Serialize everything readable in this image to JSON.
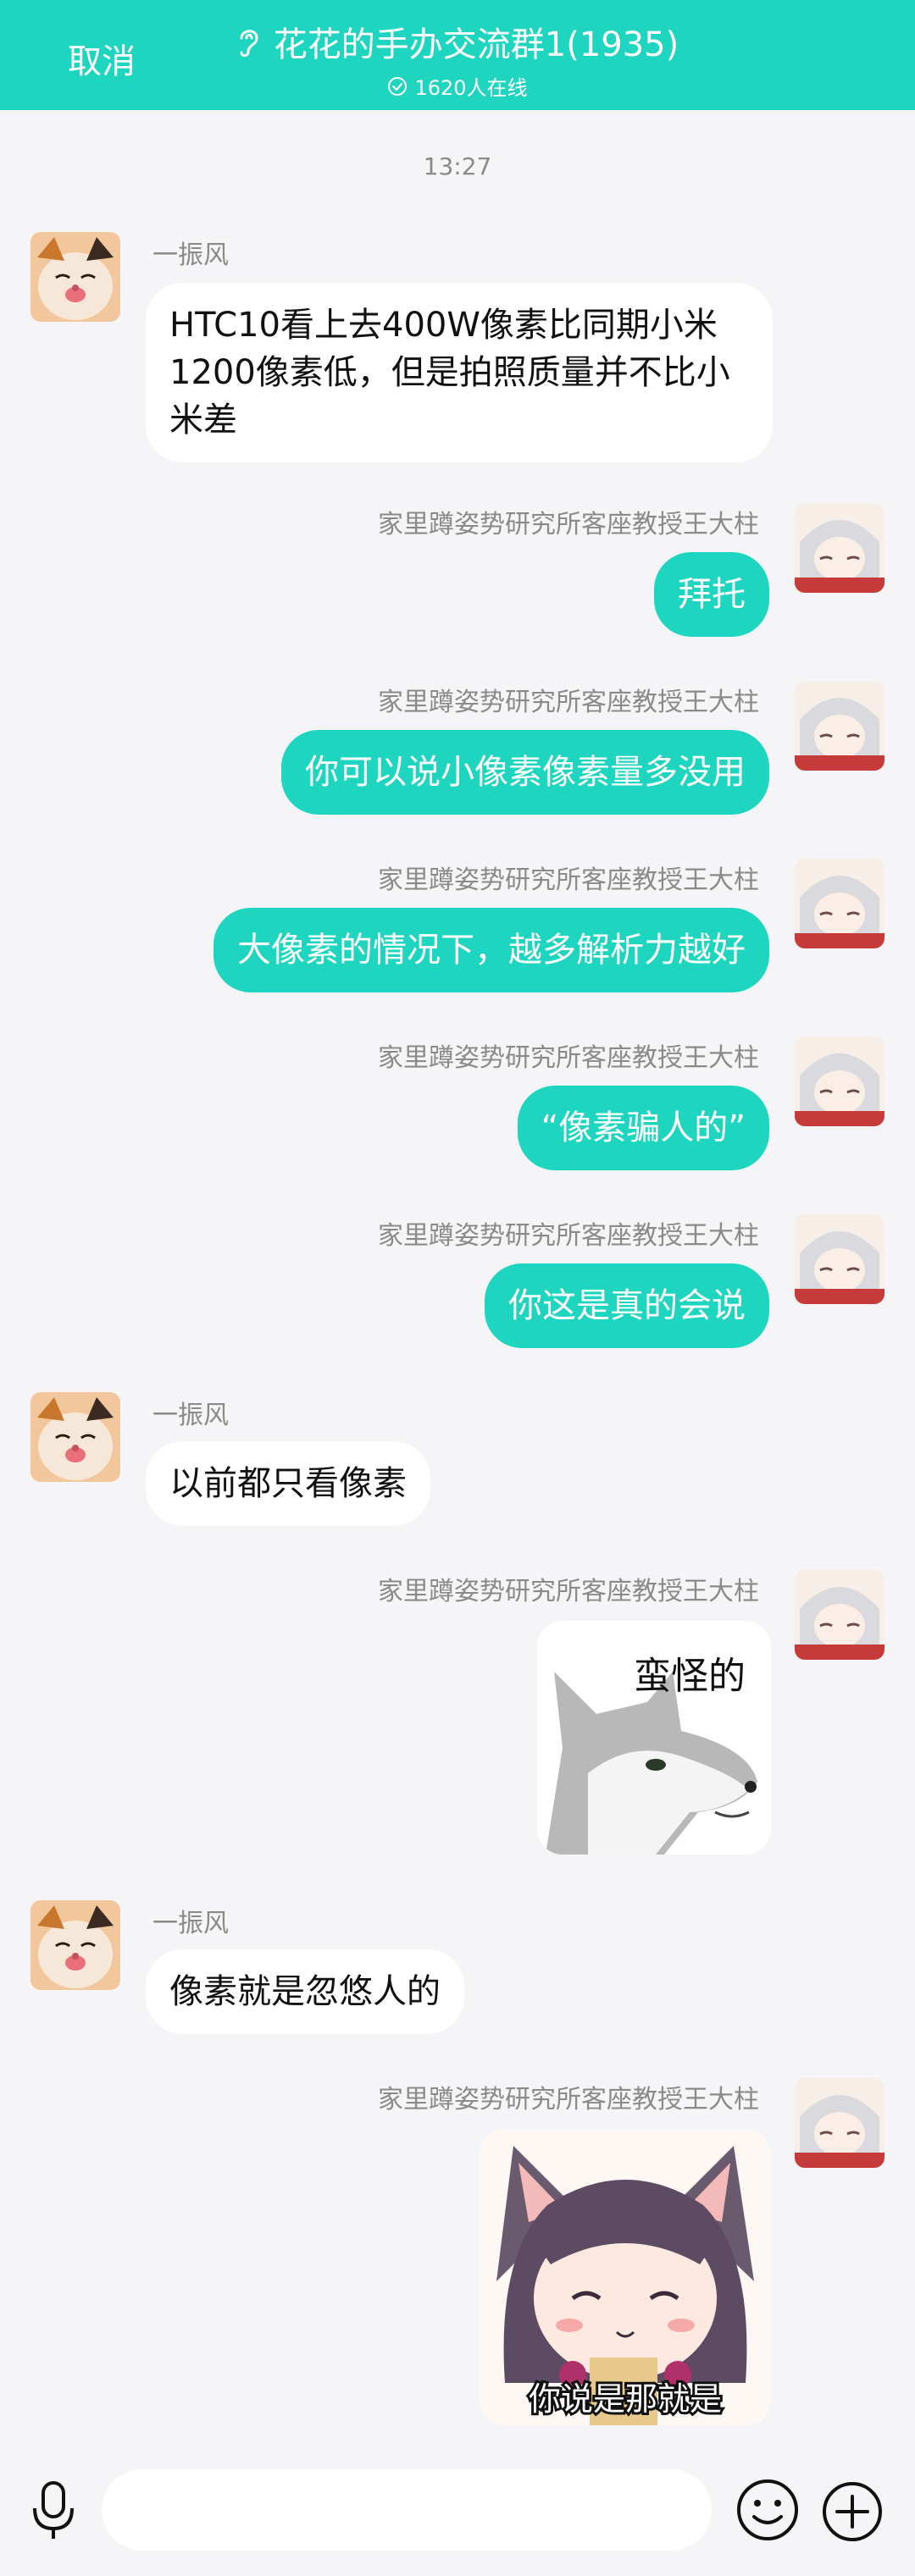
{
  "header": {
    "cancel_label": "取消",
    "title": "花花的手办交流群1(1935)",
    "online": "1620人在线"
  },
  "chat": {
    "timestamp": "13:27",
    "sender_left": "一振风",
    "sender_right": "家里蹲姿势研究所客座教授王大柱",
    "messages": [
      {
        "from": "left",
        "text": "HTC10看上去400W像素比同期小米1200像素低，但是拍照质量并不比小米差"
      },
      {
        "from": "right",
        "text": "拜托"
      },
      {
        "from": "right",
        "text": "你可以说小像素像素量多没用"
      },
      {
        "from": "right",
        "text": "大像素的情况下，越多解析力越好"
      },
      {
        "from": "right",
        "text": "“像素骗人的”"
      },
      {
        "from": "right",
        "text": "你这是真的会说"
      },
      {
        "from": "left",
        "text": "以前都只看像素"
      },
      {
        "from": "right",
        "type": "image",
        "caption": "蛮怪的"
      },
      {
        "from": "left",
        "text": "像素就是忽悠人的"
      },
      {
        "from": "right",
        "type": "image",
        "caption": "你说是那就是"
      }
    ]
  },
  "input": {
    "placeholder": ""
  },
  "icons": {
    "ear": "ear-icon",
    "online_check": "check-circle-icon",
    "mic": "microphone-icon",
    "emoji": "smile-icon",
    "plus": "plus-circle-icon"
  },
  "colors": {
    "accent": "#1ed6bf",
    "background": "#f5f5f7",
    "bubble_left": "#ffffff",
    "meta_text": "#8a8a8a"
  }
}
